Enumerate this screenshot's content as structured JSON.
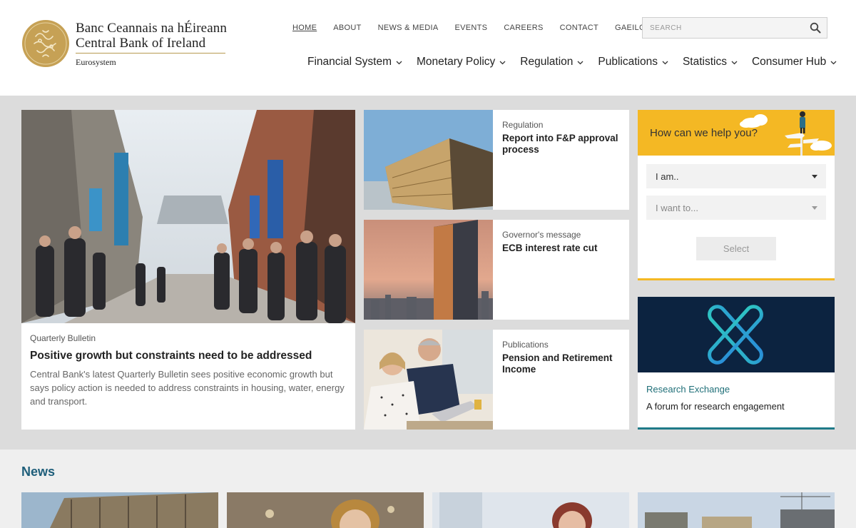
{
  "brand": {
    "line1": "Banc Ceannais na hÉireann",
    "line2": "Central Bank of Ireland",
    "line3": "Eurosystem",
    "gold": "#c6a155"
  },
  "topnav": [
    {
      "label": "HOME",
      "active": true
    },
    {
      "label": "ABOUT"
    },
    {
      "label": "NEWS & MEDIA"
    },
    {
      "label": "EVENTS"
    },
    {
      "label": "CAREERS"
    },
    {
      "label": "CONTACT"
    },
    {
      "label": "GAEILGE"
    }
  ],
  "search": {
    "placeholder": "SEARCH",
    "icon": "search-icon"
  },
  "mainnav": [
    {
      "label": "Financial System"
    },
    {
      "label": "Monetary Policy"
    },
    {
      "label": "Regulation"
    },
    {
      "label": "Publications"
    },
    {
      "label": "Statistics"
    },
    {
      "label": "Consumer Hub"
    }
  ],
  "hero": {
    "category": "Quarterly Bulletin",
    "title": "Positive growth but constraints need to be addressed",
    "description": "Central Bank's latest Quarterly Bulletin sees positive economic growth but says policy action is needed to address constraints in housing, water, energy and transport."
  },
  "cards": [
    {
      "category": "Regulation",
      "title": "Report into F&P approval process"
    },
    {
      "category": "Governor's message",
      "title": "ECB interest rate cut"
    },
    {
      "category": "Publications",
      "title": "Pension and Retirement Income"
    }
  ],
  "help": {
    "question": "How can we help you?",
    "select1": "I am..",
    "select2": "I want to...",
    "button": "Select",
    "accent": "#f4b824"
  },
  "research": {
    "category": "Research Exchange",
    "title": "A forum for research engagement",
    "accent": "#1f7a88"
  },
  "news": {
    "heading": "News"
  }
}
